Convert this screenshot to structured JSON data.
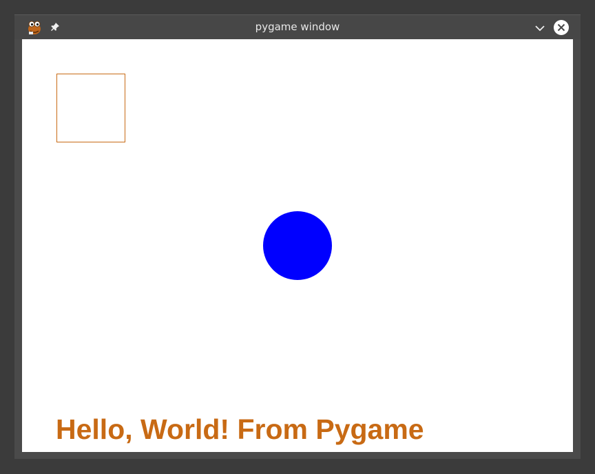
{
  "window": {
    "title": "pygame window",
    "app_icon": "pygame-snake-icon",
    "pin_icon": "pin-icon",
    "minimize_icon": "chevron-down-icon",
    "close_icon": "close-circle-icon"
  },
  "canvas": {
    "background": "#ffffff",
    "square_outline_color": "#c86a14",
    "circle_color": "#0000ff",
    "text_color": "#c86a14",
    "text": "Hello, World! From Pygame"
  }
}
